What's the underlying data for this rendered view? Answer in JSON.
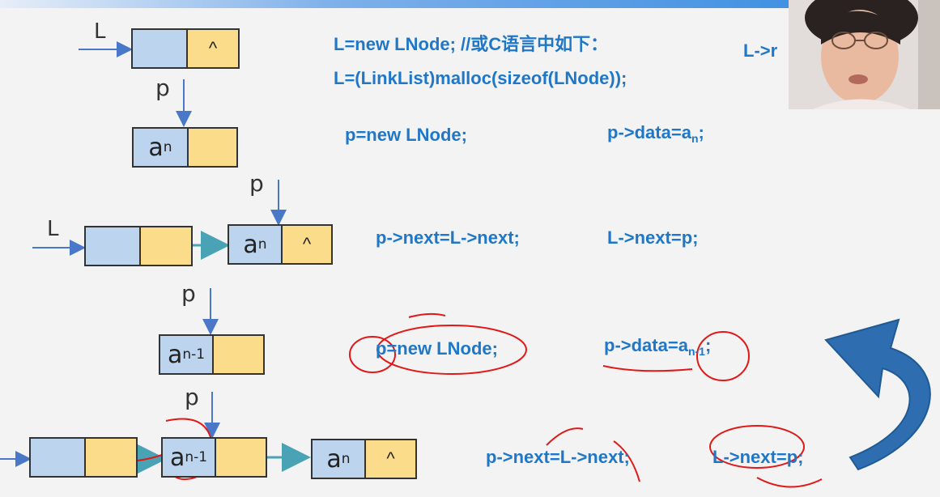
{
  "labels": {
    "L": "L",
    "p": "p"
  },
  "nodes": {
    "an": "a",
    "sub_n": "n",
    "sub_n1": "n-1",
    "null": "^"
  },
  "code": {
    "line1": "L=new LNode; //或C语言中如下：",
    "line2": "L=(LinkList)malloc(sizeof(LNode));",
    "line3": "L->r",
    "line4": "p=new LNode;",
    "line5": "p->data=a",
    "line5_sub": "n",
    "line5_end": ";",
    "line6": "p->next=L->next;",
    "line7": "L->next=p;",
    "line8": "p=new LNode;",
    "line9": "p->data=a",
    "line9_sub": "n-1",
    "line9_end": ";",
    "line10": "p->next=L->next;",
    "line11": "L->next=p;"
  },
  "colors": {
    "code": "#1f77c8",
    "data_field": "#bcd4ee",
    "next_field": "#fbdc8a",
    "pointer_arrow": "#4a78c8",
    "link_arrow": "#4aa3b5",
    "annotation": "#e01818",
    "curve_arrow": "#2e6db0"
  },
  "icons": {
    "webcam": "presenter-webcam",
    "curve": "curved-return-arrow"
  }
}
